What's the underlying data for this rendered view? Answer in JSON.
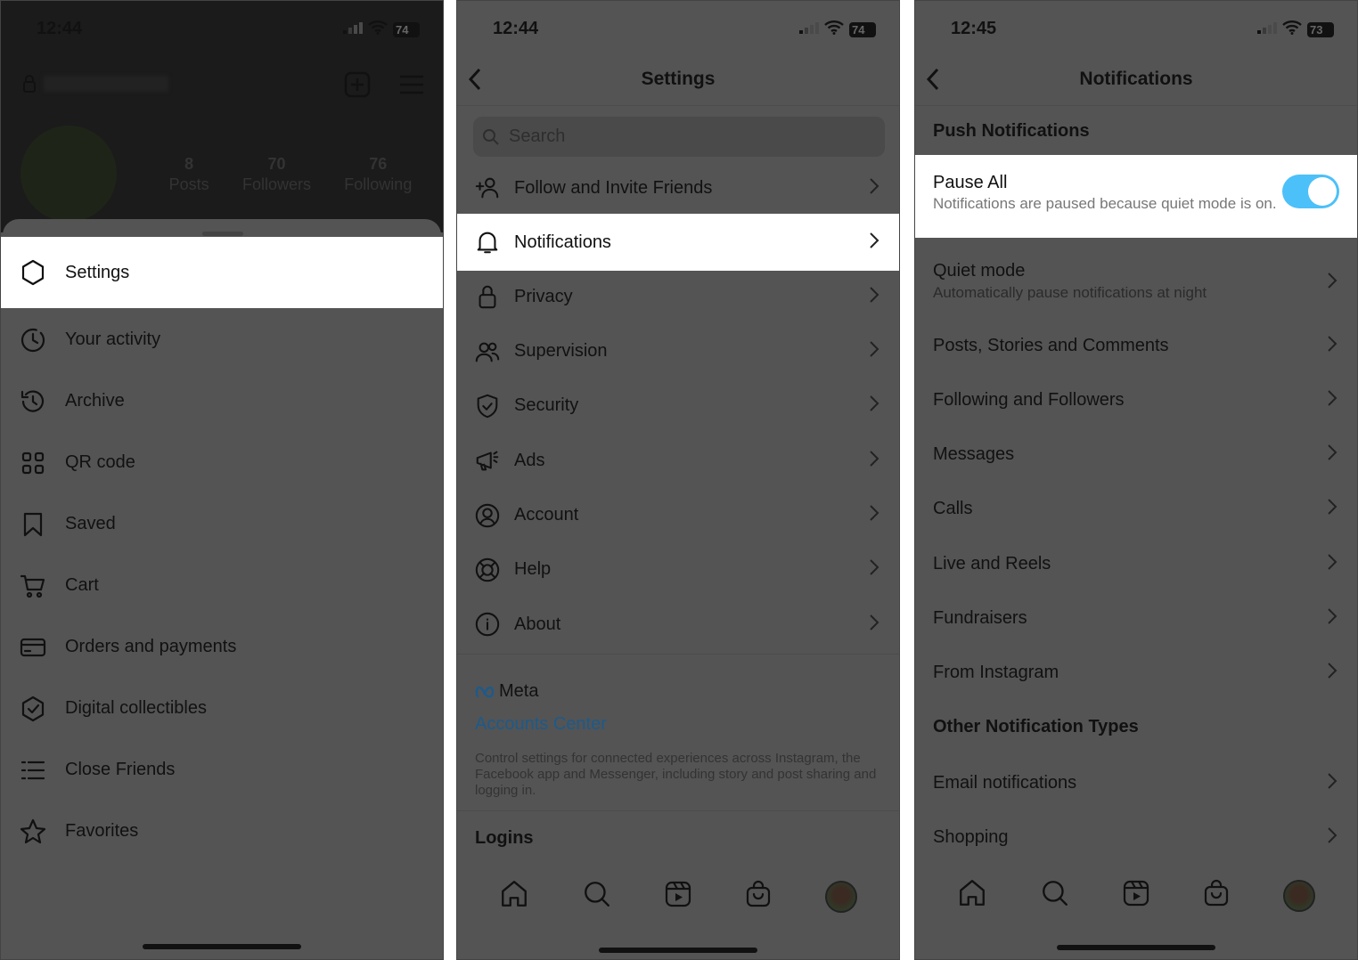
{
  "colors": {
    "overlay": "#545454",
    "dark_top": "#1b1b1b",
    "highlight": "#ffffff",
    "toggle_on": "#4cc0f9",
    "link": "#1d5a8a"
  },
  "panel1": {
    "status": {
      "time": "12:44",
      "battery": "74"
    },
    "profile": {
      "stats": [
        {
          "value": "8",
          "label": "Posts"
        },
        {
          "value": "70",
          "label": "Followers"
        },
        {
          "value": "76",
          "label": "Following"
        }
      ]
    },
    "menu": [
      {
        "label": "Settings",
        "icon": "settings-icon",
        "highlighted": true
      },
      {
        "label": "Your activity",
        "icon": "activity-icon"
      },
      {
        "label": "Archive",
        "icon": "archive-icon"
      },
      {
        "label": "QR code",
        "icon": "qr-code-icon"
      },
      {
        "label": "Saved",
        "icon": "bookmark-icon"
      },
      {
        "label": "Cart",
        "icon": "cart-icon"
      },
      {
        "label": "Orders and payments",
        "icon": "card-icon"
      },
      {
        "label": "Digital collectibles",
        "icon": "badge-check-icon"
      },
      {
        "label": "Close Friends",
        "icon": "list-icon"
      },
      {
        "label": "Favorites",
        "icon": "star-icon"
      }
    ]
  },
  "panel2": {
    "status": {
      "time": "12:44",
      "battery": "74"
    },
    "title": "Settings",
    "search_placeholder": "Search",
    "items": [
      {
        "label": "Follow and Invite Friends",
        "icon": "add-person-icon"
      },
      {
        "label": "Notifications",
        "icon": "bell-icon",
        "highlighted": true
      },
      {
        "label": "Privacy",
        "icon": "lock-icon"
      },
      {
        "label": "Supervision",
        "icon": "people-icon"
      },
      {
        "label": "Security",
        "icon": "shield-icon"
      },
      {
        "label": "Ads",
        "icon": "megaphone-icon"
      },
      {
        "label": "Account",
        "icon": "account-icon"
      },
      {
        "label": "Help",
        "icon": "lifebuoy-icon"
      },
      {
        "label": "About",
        "icon": "info-icon"
      }
    ],
    "meta": {
      "logo": "Meta",
      "link": "Accounts Center",
      "description": "Control settings for connected experiences across Instagram, the Facebook app and Messenger, including story and post sharing and logging in."
    },
    "logins": "Logins"
  },
  "panel3": {
    "status": {
      "time": "12:45",
      "battery": "73"
    },
    "title": "Notifications",
    "push_header": "Push Notifications",
    "pause_all": {
      "label": "Pause All",
      "description": "Notifications are paused because quiet mode is on.",
      "enabled": true
    },
    "quiet_mode": {
      "label": "Quiet mode",
      "description": "Automatically pause notifications at night"
    },
    "items": [
      "Posts, Stories and Comments",
      "Following and Followers",
      "Messages",
      "Calls",
      "Live and Reels",
      "Fundraisers",
      "From Instagram"
    ],
    "other_header": "Other Notification Types",
    "other_items": [
      "Email notifications",
      "Shopping"
    ]
  }
}
